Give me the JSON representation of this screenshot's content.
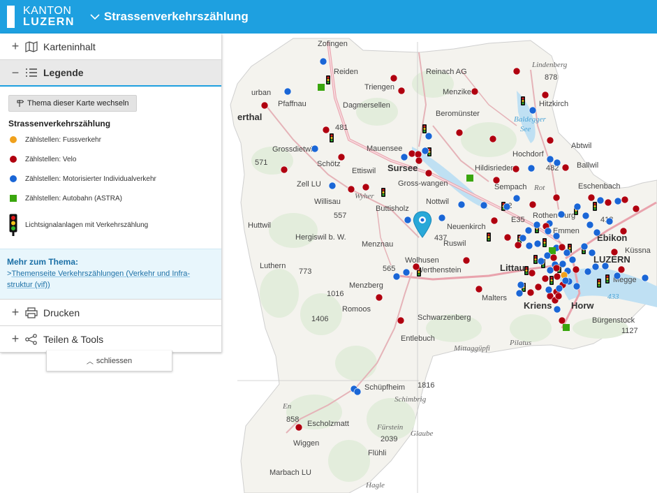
{
  "header": {
    "logo_line1": "KANTON",
    "logo_line2": "LUZERN",
    "title": "Strassenverkehrszählung"
  },
  "panel": {
    "sections": {
      "karteninhalt": "Karteninhalt",
      "legende": "Legende",
      "drucken": "Drucken",
      "teilen": "Teilen & Tools"
    },
    "theme_button": "Thema dieser Karte wechseln",
    "legend_title": "Strassenverkehrszählung",
    "legend_items": [
      {
        "label": "Zählstellen: Fussverkehr",
        "color": "#f0a11c",
        "shape": "circle"
      },
      {
        "label": "Zählstellen: Velo",
        "color": "#b0000f",
        "shape": "circle"
      },
      {
        "label": "Zählstellen: Motorisierter Individualverkehr",
        "color": "#1a66d6",
        "shape": "circle"
      },
      {
        "label": "Zählstellen: Autobahn (ASTRA)",
        "color": "#3aa60e",
        "shape": "square"
      },
      {
        "label": "Lichtsignalanlagen mit Verkehrszählung",
        "icon": "traffic-light-icon"
      }
    ],
    "more_title": "Mehr zum Thema:",
    "more_link": "Themenseite Verkehrszählungen (Verkehr und Infra-struktur (vif))",
    "close_label": "schliessen"
  },
  "map": {
    "labels": {
      "zofingen": "Zofingen",
      "reiden": "Reiden",
      "triengen": "Triengen",
      "reinach": "Reinach AG",
      "lindenberg": "Lindenberg",
      "menziken": "Menziken",
      "hitzkirch": "Hitzkirch",
      "dagmersellen": "Dagmersellen",
      "beromuenster": "Beromünster",
      "baldegger": "Baldegger",
      "see": "See",
      "pfaffnau": "Pfaffnau",
      "urban": "urban",
      "ethal": "erthal",
      "grossdietwil": "Grossdietwil",
      "mauensee": "Mauensee",
      "hochdorf": "Hochdorf",
      "abtwil": "Abtwil",
      "schoetz": "Schötz",
      "ettiswil": "Ettiswil",
      "sursee": "Sursee",
      "hildisrieden": "Hildisrieden",
      "ballwil": "Ballwil",
      "zell": "Zell LU",
      "grosswangen": "Gross-wangen",
      "sempach": "Sempach",
      "eschenbach": "Eschenbach",
      "willisau": "Willisau",
      "wyher": "Wyher",
      "nottwil": "Nottwil",
      "buttisholz": "Buttisholz",
      "rothenburg": "Rothen-burg",
      "emmen": "Emmen",
      "ebikon": "Ebikon",
      "huttwil": "Huttwil",
      "neuenkirch": "Neuenkirch",
      "hergiswil": "Hergiswil b. W.",
      "menznau": "Menznau",
      "ruswil": "Ruswil",
      "luzern": "LUZERN",
      "kussnacht": "Küssna",
      "wolhusen": "Wolhusen",
      "werthenstein": "Werthenstein",
      "littau": "Littau",
      "luthern": "Luthern",
      "menzberg": "Menzberg",
      "malters": "Malters",
      "kriens": "Kriens",
      "horw": "Horw",
      "meggen": "Megge",
      "romoos": "Romoos",
      "schwarzenberg": "Schwarzenberg",
      "buergenstock": "Bürgenstock",
      "entlebuch": "Entlebuch",
      "mittaggupfi": "Mittaggüpfi",
      "pilatus": "Pilatus",
      "schuepfheim": "Schüpfheim",
      "schimbrig": "Schimbrig",
      "escholzmatt": "Escholzmatt",
      "fuerstein": "Fürstein",
      "glaubenberg": "Glaube",
      "wiggen": "Wiggen",
      "fluehli": "Flühli",
      "marbach": "Marbach LU",
      "hagleren": "Hagle",
      "rot": "Rot",
      "enziwiggen": "En",
      "a2": "A2",
      "e35": "E35",
      "h481": "481",
      "h557": "557",
      "h571": "571",
      "h773": "773",
      "h1016": "1016",
      "h1406": "1406",
      "h878": "878",
      "h482": "482",
      "h418": "418",
      "h433": "433",
      "h1816": "1816",
      "h858": "858",
      "h2039": "2039",
      "h565": "565",
      "h437": "437",
      "h1127": "1127"
    }
  }
}
